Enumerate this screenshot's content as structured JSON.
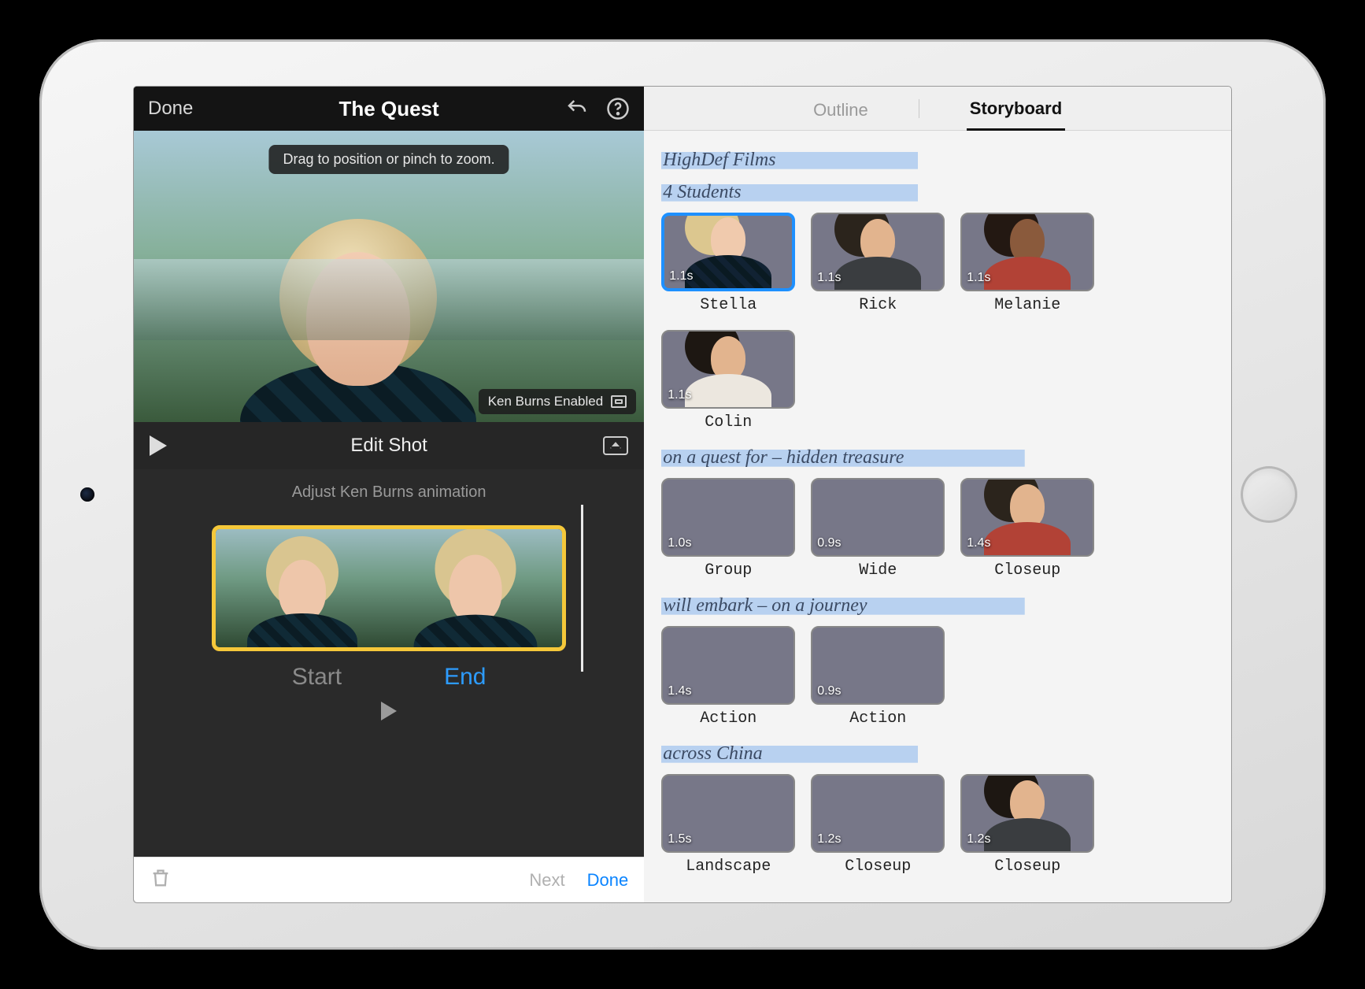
{
  "editor": {
    "done_label": "Done",
    "title": "The Quest",
    "viewer_hint": "Drag to position or pinch to zoom.",
    "ken_burns_label": "Ken Burns Enabled",
    "edit_shot_label": "Edit Shot",
    "adjust_label": "Adjust Ken Burns animation",
    "start_label": "Start",
    "end_label": "End",
    "bottom_next": "Next",
    "bottom_done": "Done"
  },
  "right_tabs": {
    "outline": "Outline",
    "storyboard": "Storyboard",
    "active": "storyboard"
  },
  "sections": [
    {
      "heading": "HighDef Films",
      "sub_heading": "4 Students",
      "shots": [
        {
          "id": "stella",
          "label": "Stella",
          "duration": "1.1s",
          "bg": "bg-stella",
          "face": {
            "h": "h-blond",
            "f": "f-lt",
            "s": "s-plaid"
          },
          "selected": true
        },
        {
          "id": "rick",
          "label": "Rick",
          "duration": "1.1s",
          "bg": "bg-rick",
          "face": {
            "h": "h-dark",
            "f": "f-md",
            "s": "s-gray"
          }
        },
        {
          "id": "melanie",
          "label": "Melanie",
          "duration": "1.1s",
          "bg": "bg-mel",
          "face": {
            "h": "h-afro",
            "f": "f-dk",
            "s": "s-red"
          }
        },
        {
          "id": "colin",
          "label": "Colin",
          "duration": "1.1s",
          "bg": "bg-colin",
          "face": {
            "h": "h-short",
            "f": "f-md",
            "s": "s-white"
          }
        }
      ]
    },
    {
      "heading": "on a quest for – hidden treasure",
      "shots": [
        {
          "id": "group",
          "label": "Group",
          "duration": "1.0s",
          "bg": "bg-fire"
        },
        {
          "id": "wide",
          "label": "Wide",
          "duration": "0.9s",
          "bg": "bg-wide"
        },
        {
          "id": "closeup1",
          "label": "Closeup",
          "duration": "1.4s",
          "bg": "bg-moto",
          "face": {
            "h": "h-dark",
            "f": "f-md",
            "s": "s-red"
          }
        }
      ]
    },
    {
      "heading": "will embark – on a journey",
      "shots": [
        {
          "id": "action1",
          "label": "Action",
          "duration": "1.4s",
          "bg": "bg-street"
        },
        {
          "id": "action2",
          "label": "Action",
          "duration": "0.9s",
          "bg": "bg-fire"
        }
      ]
    },
    {
      "heading": "across China",
      "shots": [
        {
          "id": "landscape",
          "label": "Landscape",
          "duration": "1.5s",
          "bg": "bg-land"
        },
        {
          "id": "closeup2",
          "label": "Closeup",
          "duration": "1.2s",
          "bg": "bg-buff"
        },
        {
          "id": "closeup3",
          "label": "Closeup",
          "duration": "1.2s",
          "bg": "bg-farmer",
          "face": {
            "h": "h-short",
            "f": "f-md",
            "s": "s-gray"
          }
        }
      ]
    }
  ]
}
